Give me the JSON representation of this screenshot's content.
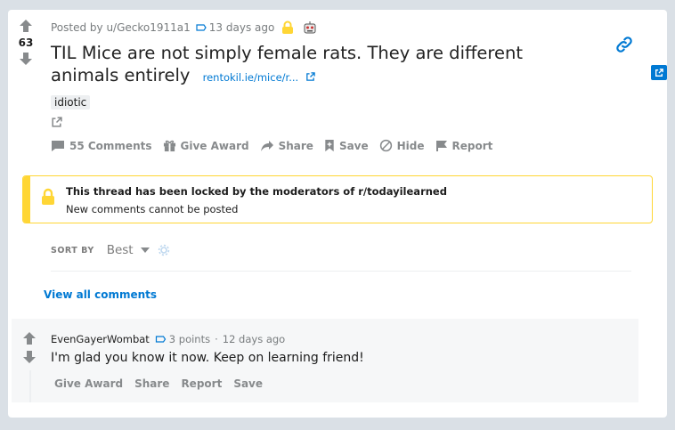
{
  "post": {
    "score": "63",
    "posted_by": "Posted by u/Gecko1911a1",
    "age": "13 days ago",
    "title": "TIL Mice are not simply female rats. They are different animals entirely",
    "domain": "rentokil.ie/mice/r...",
    "flair": "idiotic",
    "actions": {
      "comments": "55 Comments",
      "award": "Give Award",
      "share": "Share",
      "save": "Save",
      "hide": "Hide",
      "report": "Report"
    }
  },
  "lock_notice": {
    "title": "This thread has been locked by the moderators of r/todayilearned",
    "subtitle": "New comments cannot be posted"
  },
  "sort": {
    "label": "SORT BY",
    "value": "Best"
  },
  "view_all": "View all comments",
  "comment": {
    "author": "EvenGayerWombat",
    "points": "3 points",
    "separator": "·",
    "age": "12 days ago",
    "body": "I'm glad you know it now. Keep on learning friend!",
    "actions": {
      "award": "Give Award",
      "share": "Share",
      "report": "Report",
      "save": "Save"
    }
  },
  "colors": {
    "background": "#dae0e6",
    "link": "#0079d3",
    "lock_yellow": "#ffd635",
    "muted": "#878a8c"
  },
  "icons": [
    "upvote-icon",
    "downvote-icon",
    "tag-icon",
    "lock-award-icon",
    "robot-award-icon",
    "external-link-icon",
    "comment-icon",
    "gift-icon",
    "share-icon",
    "save-icon",
    "hide-icon",
    "report-icon",
    "link-icon",
    "padlock-icon",
    "caret-down-icon",
    "gear-icon"
  ]
}
